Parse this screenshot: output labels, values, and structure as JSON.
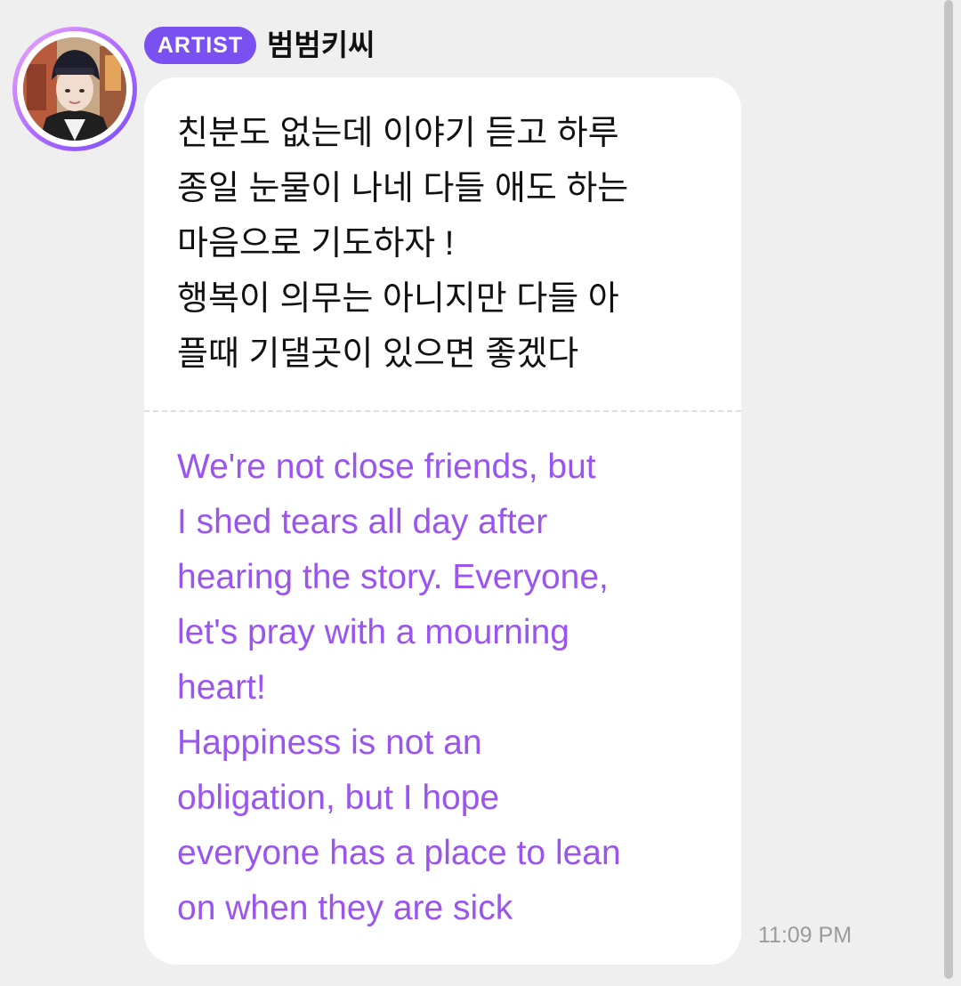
{
  "message": {
    "badge_label": "ARTIST",
    "author": "범범키씨",
    "avatar_icon": "profile-photo",
    "text_original": "친분도 없는데 이야기 듣고 하루\n종일 눈물이 나네 다들 애도 하는\n마음으로 기도하자 !\n행복이 의무는 아니지만 다들 아\n플때 기댈곳이 있으면 좋겠다",
    "text_translated": "We're not close friends, but\nI shed tears all day after\nhearing the story. Everyone,\nlet's pray with a mourning\nheart!\nHappiness is not an\nobligation, but I hope\neveryone has a place to lean\non when they are sick",
    "time": "11:09 PM"
  },
  "colors": {
    "background": "#efeff0",
    "bubble": "#ffffff",
    "badge": "#7a50f0",
    "translation_text": "#9a55ef",
    "timestamp": "#9b9b9b"
  }
}
